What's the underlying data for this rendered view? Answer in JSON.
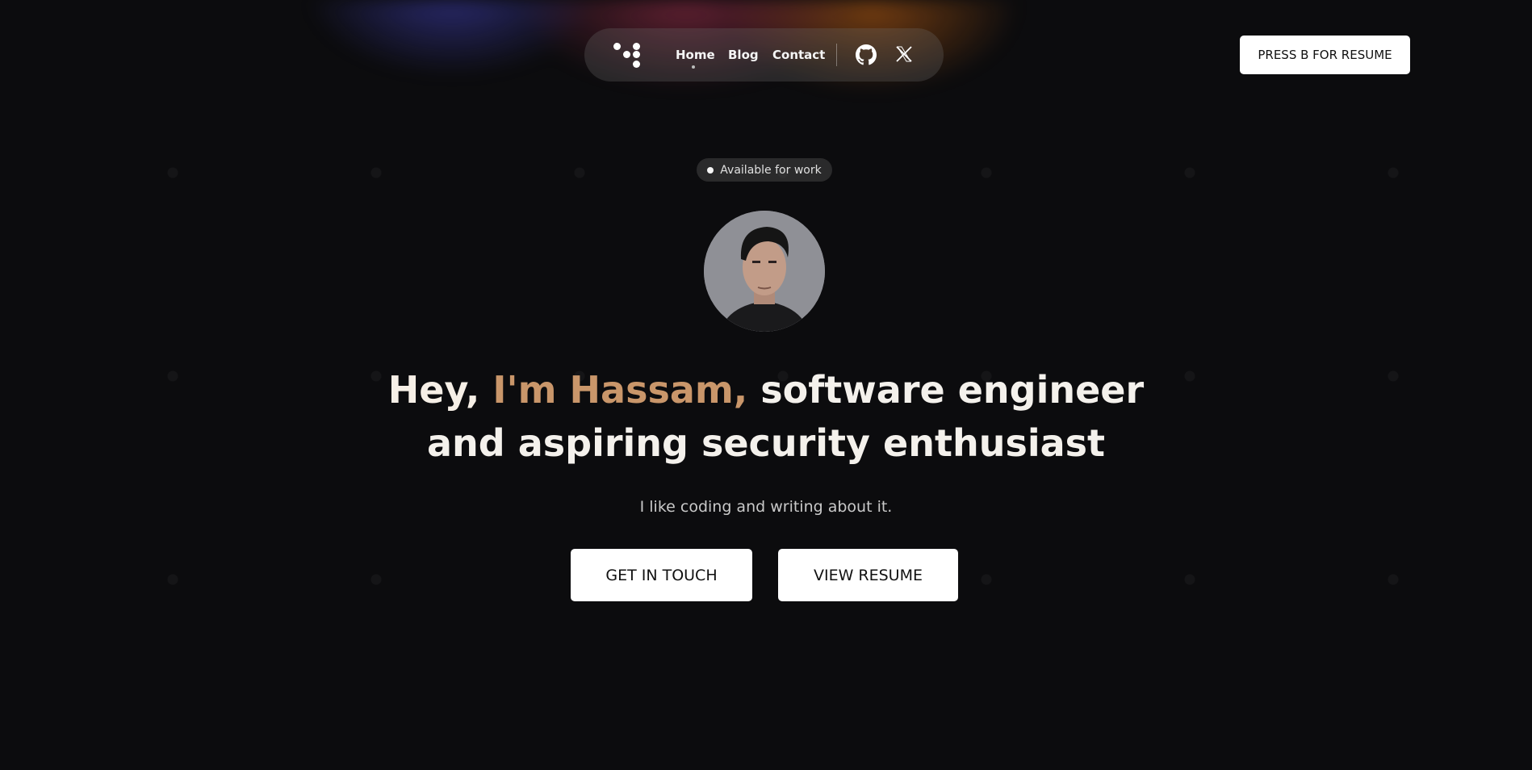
{
  "nav": {
    "links": [
      {
        "label": "Home",
        "active": true
      },
      {
        "label": "Blog",
        "active": false
      },
      {
        "label": "Contact",
        "active": false
      }
    ],
    "icons": [
      "github-icon",
      "x-icon"
    ]
  },
  "resume_top_label": "PRESS B FOR RESUME",
  "badge": {
    "label": "Available for work"
  },
  "hero": {
    "hey": "Hey,",
    "name": "I'm Hassam,",
    "rest_line1": "software engineer",
    "line2": "and aspiring security enthusiast",
    "subtitle": "I like coding and writing about it."
  },
  "cta": {
    "primary": "GET IN TOUCH",
    "secondary": "VIEW RESUME"
  },
  "colors": {
    "background": "#0c0c0e",
    "accent_name": "#c9966a",
    "button_bg": "#ffffff"
  }
}
